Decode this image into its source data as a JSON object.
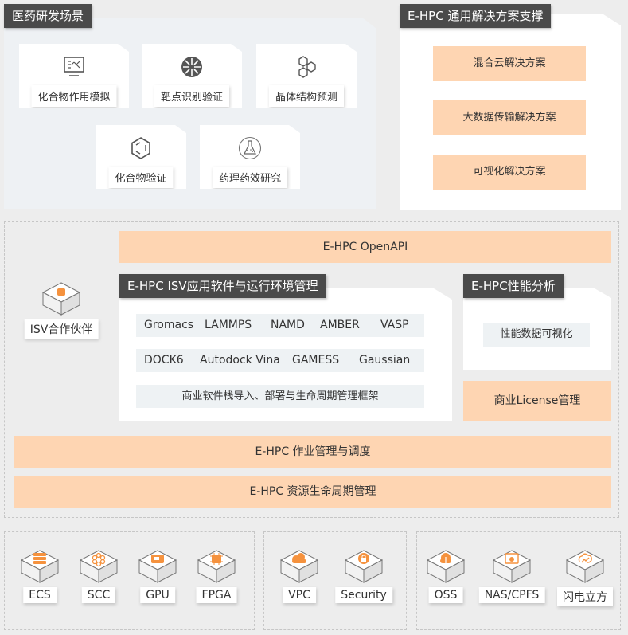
{
  "scenarios": {
    "title": "医药研发场景",
    "items": [
      {
        "label": "化合物作用模拟",
        "icon": "molecule-simulation-monitor-icon"
      },
      {
        "label": "靶点识别验证",
        "icon": "target-wheel-icon"
      },
      {
        "label": "晶体结构预测",
        "icon": "hexagon-cluster-icon"
      },
      {
        "label": "化合物验证",
        "icon": "benzene-ring-icon"
      },
      {
        "label": "药理药效研究",
        "icon": "flask-icon"
      }
    ]
  },
  "solutions": {
    "title": "E-HPC 通用解决方案支撑",
    "items": [
      "混合云解决方案",
      "大数据传输解决方案",
      "可视化解决方案"
    ]
  },
  "openapi": "E-HPC OpenAPI",
  "isv_partner": {
    "label": "ISV合作伙伴",
    "icon": "isv-partner-cube-icon"
  },
  "isv": {
    "title": "E-HPC ISV应用软件与运行环境管理",
    "row1": [
      "Gromacs",
      "LAMMPS",
      "NAMD",
      "AMBER",
      "VASP"
    ],
    "row2": [
      "DOCK6",
      "Autodock Vina",
      "GAMESS",
      "Gaussian"
    ],
    "row3": "商业软件栈导入、部署与生命周期管理框架"
  },
  "perf": {
    "title": "E-HPC性能分析",
    "item": "性能数据可视化"
  },
  "license": "商业License管理",
  "job_mgmt": "E-HPC 作业管理与调度",
  "resource_mgmt": "E-HPC 资源生命周期管理",
  "compute": [
    {
      "label": "ECS",
      "icon": "server-stack-icon"
    },
    {
      "label": "SCC",
      "icon": "cluster-icon"
    },
    {
      "label": "GPU",
      "icon": "gpu-card-icon"
    },
    {
      "label": "FPGA",
      "icon": "chip-icon"
    }
  ],
  "network": [
    {
      "label": "VPC",
      "icon": "cloud-network-icon"
    },
    {
      "label": "Security",
      "icon": "shield-lock-icon"
    }
  ],
  "storage": [
    {
      "label": "OSS",
      "icon": "cloud-upload-icon"
    },
    {
      "label": "NAS/CPFS",
      "icon": "folder-cloud-icon"
    },
    {
      "label": "闪电立方",
      "icon": "cloud-lightning-icon"
    }
  ],
  "colors": {
    "accent_orange": "#f5923e",
    "peach": "#fed5b2",
    "dark_title": "#4a4a4a",
    "panel_bg": "#eef1f4",
    "page_bg": "#ededed"
  }
}
